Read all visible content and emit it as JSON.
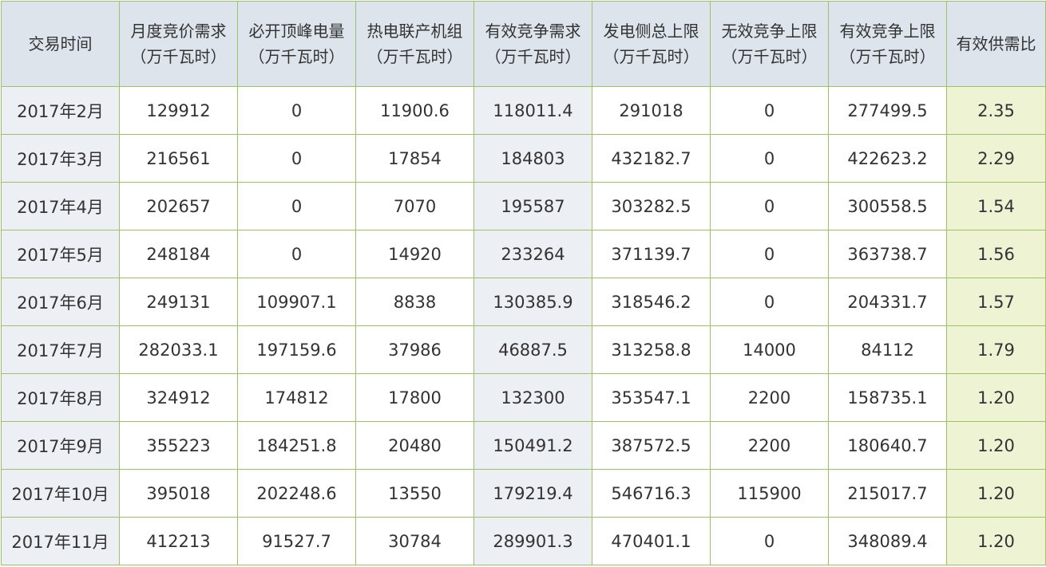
{
  "headers": [
    {
      "line1": "交易时间",
      "line2": ""
    },
    {
      "line1": "月度竞价需求",
      "line2": "（万千瓦时）"
    },
    {
      "line1": "必开顶峰电量",
      "line2": "（万千瓦时）"
    },
    {
      "line1": "热电联产机组",
      "line2": "（万千瓦时）"
    },
    {
      "line1": "有效竞争需求",
      "line2": "（万千瓦时）"
    },
    {
      "line1": "发电侧总上限",
      "line2": "（万千瓦时）"
    },
    {
      "line1": "无效竞争上限",
      "line2": "（万千瓦时）"
    },
    {
      "line1": "有效竞争上限",
      "line2": "（万千瓦时）"
    },
    {
      "line1": "有效供需比",
      "line2": ""
    }
  ],
  "rows": [
    [
      "2017年2月",
      "129912",
      "0",
      "11900.6",
      "118011.4",
      "291018",
      "0",
      "277499.5",
      "2.35"
    ],
    [
      "2017年3月",
      "216561",
      "0",
      "17854",
      "184803",
      "432182.7",
      "0",
      "422623.2",
      "2.29"
    ],
    [
      "2017年4月",
      "202657",
      "0",
      "7070",
      "195587",
      "303282.5",
      "0",
      "300558.5",
      "1.54"
    ],
    [
      "2017年5月",
      "248184",
      "0",
      "14920",
      "233264",
      "371139.7",
      "0",
      "363738.7",
      "1.56"
    ],
    [
      "2017年6月",
      "249131",
      "109907.1",
      "8838",
      "130385.9",
      "318546.2",
      "0",
      "204331.7",
      "1.57"
    ],
    [
      "2017年7月",
      "282033.1",
      "197159.6",
      "37986",
      "46887.5",
      "313258.8",
      "14000",
      "84112",
      "1.79"
    ],
    [
      "2017年8月",
      "324912",
      "174812",
      "17800",
      "132300",
      "353547.1",
      "2200",
      "158735.1",
      "1.20"
    ],
    [
      "2017年9月",
      "355223",
      "184251.8",
      "20480",
      "150491.2",
      "387572.5",
      "2200",
      "180640.7",
      "1.20"
    ],
    [
      "2017年10月",
      "395018",
      "202248.6",
      "13550",
      "179219.4",
      "546716.3",
      "115900",
      "215017.7",
      "1.20"
    ],
    [
      "2017年11月",
      "412213",
      "91527.7",
      "30784",
      "289901.3",
      "470401.1",
      "0",
      "348089.4",
      "1.20"
    ]
  ],
  "colors": {
    "border": "#9bc264",
    "header_bg": "#dde4ec",
    "alt_col_bg": "#eceff4",
    "ratio_col_bg": "#eef3d4",
    "text": "#333333"
  }
}
